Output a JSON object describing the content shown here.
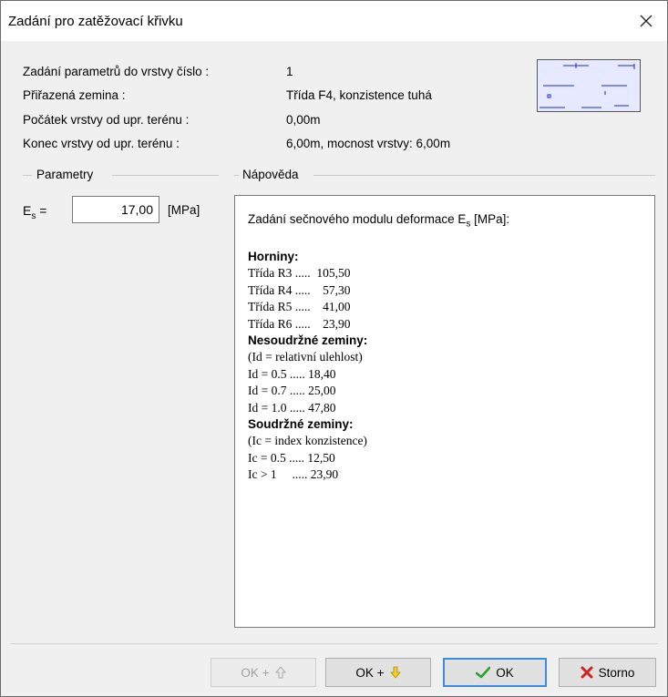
{
  "window": {
    "title": "Zadání pro zatěžovací křivku"
  },
  "info": {
    "rows": [
      {
        "label": "Zadání parametrů do vrstvy číslo :",
        "value": "1"
      },
      {
        "label": "Přiřazená zemina :",
        "value": "Třída F4, konzistence tuhá"
      },
      {
        "label": "Počátek vrstvy od upr. terénu :",
        "value": "0,00m"
      },
      {
        "label": "Konec vrstvy od upr. terénu :",
        "value": "6,00m, mocnost vrstvy: 6,00m"
      }
    ]
  },
  "parameters": {
    "group_label": "Parametry",
    "es_label": "E",
    "es_sub": "s",
    "es_eq": "=",
    "es_value": "17,00",
    "es_unit": "[MPa]"
  },
  "help": {
    "group_label": "Nápověda",
    "intro_prefix": "Zadání sečnového modulu deformace E",
    "intro_sub": "s",
    "intro_suffix": " [MPa]:",
    "sections": [
      {
        "heading": "Horniny:",
        "lines": [
          "Třída R3 .....  105,50",
          "Třída R4 .....    57,30",
          "Třída R5 .....    41,00",
          "Třída R6 .....    23,90"
        ]
      },
      {
        "heading": "Nesoudržné zeminy:",
        "lines": [
          "(Id = relativní ulehlost)",
          "Id = 0.5 ..... 18,40",
          "Id = 0.7 ..... 25,00",
          "Id = 1.0 ..... 47,80"
        ]
      },
      {
        "heading": "Soudržné zeminy:",
        "lines": [
          "(Ic = index konzistence)",
          "Ic = 0.5 ..... 12,50",
          "Ic > 1     ..... 23,90"
        ]
      }
    ]
  },
  "buttons": {
    "ok_up": "OK + ",
    "ok_down": "OK + ",
    "ok": "OK",
    "cancel": "Storno"
  },
  "colors": {
    "preview_fill": "#e6e9ff",
    "preview_lines": "#1a2cc8",
    "ok_check": "#2aa12a",
    "cancel_x": "#d42020",
    "arrow_down": "#e0b000"
  }
}
